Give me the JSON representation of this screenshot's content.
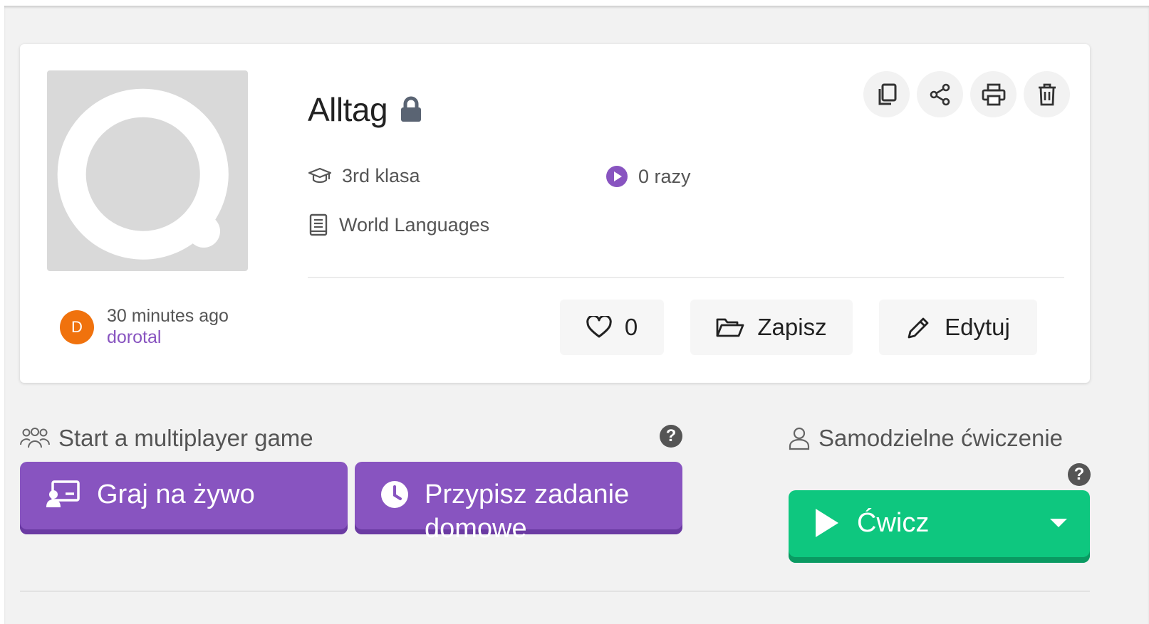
{
  "quiz": {
    "title": "Alltag",
    "grade": "3rd klasa",
    "plays": "0 razy",
    "subject": "World Languages",
    "author_time": "30 minutes ago",
    "author_name": "dorotal",
    "author_initial": "D",
    "likes": "0"
  },
  "actions": {
    "save_label": "Zapisz",
    "edit_label": "Edytuj"
  },
  "icons": {
    "lock": "lock-icon",
    "grade": "graduation-cap-icon",
    "plays": "play-circle-icon",
    "subject": "book-icon",
    "copy": "copy-icon",
    "share": "share-icon",
    "print": "print-icon",
    "delete": "trash-icon",
    "like": "heart-icon",
    "save": "folder-open-icon",
    "edit": "pencil-icon",
    "multiplayer": "users-icon",
    "solo": "user-icon",
    "help": "question-circle-icon",
    "live": "presentation-icon",
    "homework": "clock-icon",
    "practice": "play-icon",
    "dropdown": "caret-down-icon"
  },
  "multiplayer": {
    "label": "Start a multiplayer game",
    "live_label": "Graj na żywo",
    "homework_label": "Przypisz zadanie domowe"
  },
  "solo": {
    "label": "Samodzielne ćwiczenie",
    "practice_label": "Ćwicz"
  },
  "colors": {
    "brand_purple": "#8854c0",
    "practice_green": "#0ec77f",
    "avatar_orange": "#f0720d"
  }
}
